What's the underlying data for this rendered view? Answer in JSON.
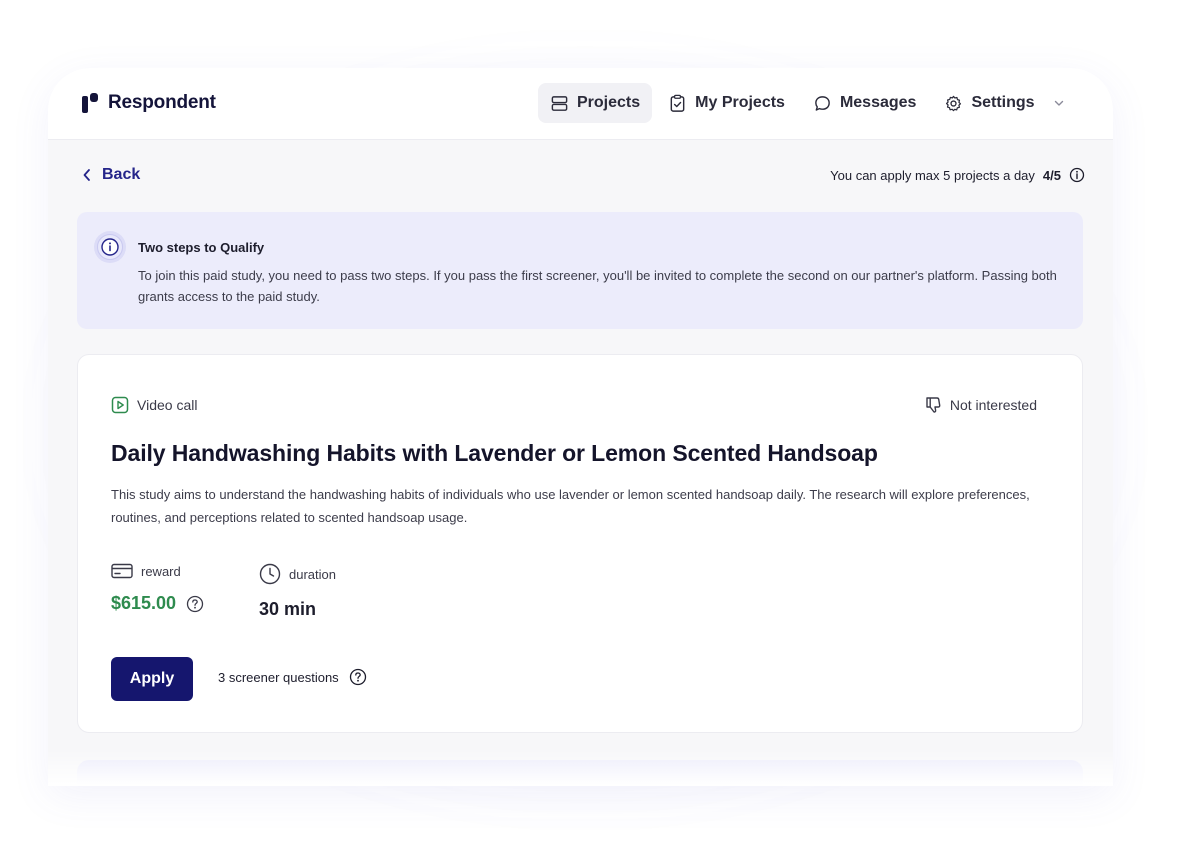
{
  "brand": {
    "name": "Respondent"
  },
  "nav": {
    "items": [
      {
        "label": "Projects",
        "icon": "projects-icon",
        "active": true
      },
      {
        "label": "My Projects",
        "icon": "clipboard-check-icon",
        "active": false
      },
      {
        "label": "Messages",
        "icon": "message-bubble-icon",
        "active": false
      },
      {
        "label": "Settings",
        "icon": "gear-icon",
        "active": false
      }
    ]
  },
  "back": {
    "label": "Back"
  },
  "apply_limit": {
    "text": "You can apply max 5 projects a day",
    "count": "4/5"
  },
  "banner": {
    "title": "Two steps to Qualify",
    "text": "To join this paid study, you need to pass two steps. If you pass the first screener, you'll be invited to complete the second on our partner's platform. Passing both grants access to the paid study."
  },
  "project": {
    "type_label": "Video call",
    "not_interested_label": "Not interested",
    "title": "Daily Handwashing Habits with Lavender or Lemon Scented Handsoap",
    "description": "This study aims to understand the handwashing habits of individuals who use lavender or lemon scented handsoap daily. The research will explore preferences, routines, and perceptions related to scented handsoap usage.",
    "reward_label": "reward",
    "reward_value": "$615.00",
    "duration_label": "duration",
    "duration_value": "30 min",
    "apply_label": "Apply",
    "screener_text": "3 screener questions"
  },
  "colors": {
    "brand_navy": "#15166e",
    "reward_green": "#2e8b4e",
    "banner_bg": "#ececfb",
    "link_blue": "#25258a"
  }
}
